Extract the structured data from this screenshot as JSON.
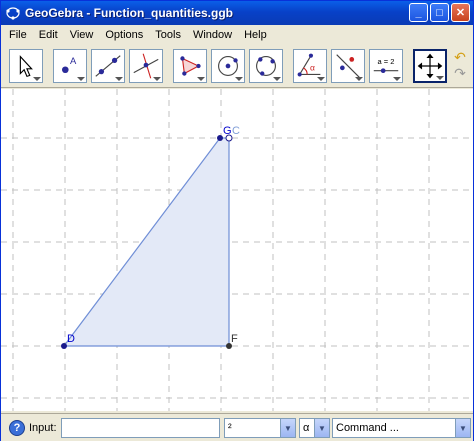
{
  "window": {
    "title": "GeoGebra - Function_quantities.ggb",
    "buttons": {
      "minimize": "_",
      "maximize": "□",
      "close": "✕"
    }
  },
  "menu": [
    "File",
    "Edit",
    "View",
    "Options",
    "Tools",
    "Window",
    "Help"
  ],
  "toolbar": {
    "tools": [
      {
        "name": "move-tool-icon"
      },
      {
        "name": "new-point-tool-icon",
        "label": "A"
      },
      {
        "name": "line-tool-icon"
      },
      {
        "name": "perpendicular-line-tool-icon"
      },
      {
        "name": "polygon-tool-icon"
      },
      {
        "name": "circle-center-point-tool-icon"
      },
      {
        "name": "circle-three-points-tool-icon"
      },
      {
        "name": "angle-tool-icon",
        "label": "α"
      },
      {
        "name": "reflect-tool-icon"
      },
      {
        "name": "slider-tool-icon",
        "label": "a = 2"
      },
      {
        "name": "move-graphics-view-tool-icon"
      }
    ],
    "undo": "↶",
    "redo": "↷"
  },
  "canvas": {
    "points": {
      "D": "D",
      "G": "G",
      "C": "C",
      "F": "F"
    },
    "colors": {
      "grid": "#c0c0c0",
      "polygon_fill": "#e3e9f7",
      "polygon_stroke": "#6f8ed6",
      "label": "#0000cc"
    }
  },
  "inputbar": {
    "help": "?",
    "label": "Input:",
    "value": "",
    "symbol_combo": "²",
    "greek_combo": "α",
    "command_combo": "Command ..."
  }
}
